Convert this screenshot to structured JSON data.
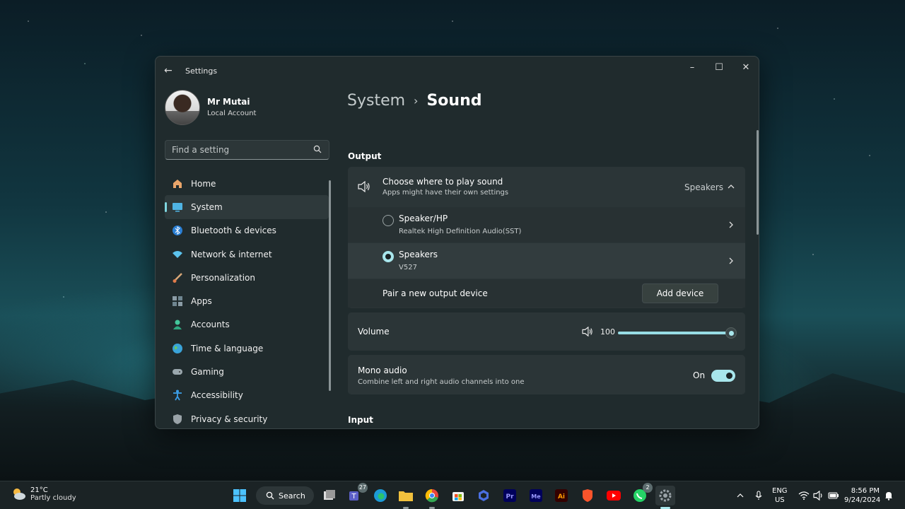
{
  "window": {
    "app_title": "Settings",
    "user": {
      "name": "Mr Mutai",
      "account_type": "Local Account"
    },
    "search": {
      "placeholder": "Find a setting"
    }
  },
  "sidebar": {
    "items": [
      {
        "label": "Home",
        "icon": "home-icon"
      },
      {
        "label": "System",
        "icon": "system-icon",
        "active": true
      },
      {
        "label": "Bluetooth & devices",
        "icon": "bluetooth-icon"
      },
      {
        "label": "Network & internet",
        "icon": "wifi-icon"
      },
      {
        "label": "Personalization",
        "icon": "brush-icon"
      },
      {
        "label": "Apps",
        "icon": "apps-icon"
      },
      {
        "label": "Accounts",
        "icon": "person-icon"
      },
      {
        "label": "Time & language",
        "icon": "globe-icon"
      },
      {
        "label": "Gaming",
        "icon": "gamepad-icon"
      },
      {
        "label": "Accessibility",
        "icon": "accessibility-icon"
      },
      {
        "label": "Privacy & security",
        "icon": "shield-icon"
      }
    ]
  },
  "breadcrumb": {
    "parent": "System",
    "current": "Sound"
  },
  "output": {
    "section_title": "Output",
    "choose": {
      "title": "Choose where to play sound",
      "subtitle": "Apps might have their own settings",
      "value": "Speakers"
    },
    "devices": [
      {
        "name": "Speaker/HP",
        "detail": "Realtek High Definition Audio(SST)",
        "selected": false
      },
      {
        "name": "Speakers",
        "detail": "V527",
        "selected": true
      }
    ],
    "pair": {
      "label": "Pair a new output device",
      "button": "Add device"
    },
    "volume": {
      "label": "Volume",
      "value": "100",
      "level": 1.0
    },
    "mono": {
      "title": "Mono audio",
      "subtitle": "Combine left and right audio channels into one",
      "state_label": "On",
      "enabled": true
    }
  },
  "input": {
    "section_title": "Input"
  },
  "taskbar": {
    "weather": {
      "temp": "21°C",
      "desc": "Partly cloudy"
    },
    "search_label": "Search",
    "teams_badge": "27",
    "whatsapp_badge": "2",
    "apps": [
      "start-icon",
      "search",
      "task-view-icon",
      "teams-icon",
      "edge-icon",
      "file-explorer-icon",
      "chrome-icon",
      "store-icon",
      "copilot-icon",
      "premiere-icon",
      "media-encoder-icon",
      "illustrator-icon",
      "brave-icon",
      "youtube-icon",
      "whatsapp-icon",
      "settings-icon"
    ],
    "language": {
      "line1": "ENG",
      "line2": "US"
    },
    "clock": {
      "time": "8:56 PM",
      "date": "9/24/2024"
    }
  },
  "colors": {
    "accent": "#a8e6ec",
    "window_bg": "#202b2d",
    "card_bg": "#2b3537"
  }
}
